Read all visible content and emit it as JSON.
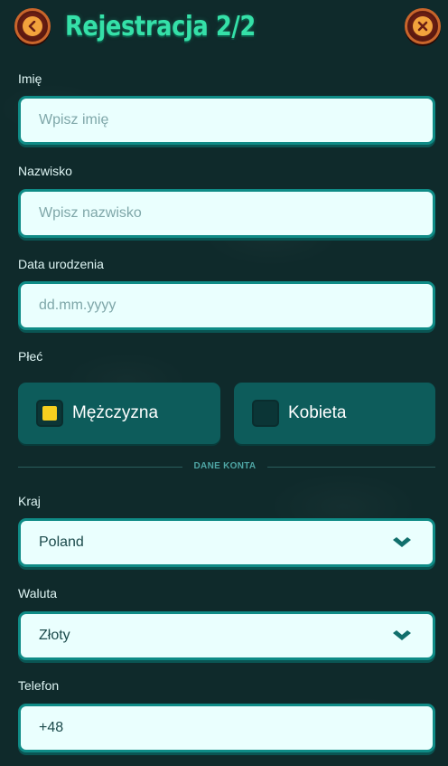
{
  "header": {
    "title": "Rejestracja 2/2",
    "back_icon": "back-arrow-icon",
    "close_icon": "close-x-icon"
  },
  "form": {
    "first_name": {
      "label": "Imię",
      "placeholder": "Wpisz imię"
    },
    "last_name": {
      "label": "Nazwisko",
      "placeholder": "Wpisz nazwisko"
    },
    "birth_date": {
      "label": "Data urodzenia",
      "placeholder": "dd.mm.yyyy"
    },
    "gender": {
      "label": "Płeć",
      "options": [
        {
          "label": "Mężczyzna",
          "selected": true
        },
        {
          "label": "Kobieta",
          "selected": false
        }
      ]
    },
    "section_title": "DANE KONTA",
    "country": {
      "label": "Kraj",
      "value": "Poland"
    },
    "currency": {
      "label": "Waluta",
      "value": "Złoty"
    },
    "phone": {
      "label": "Telefon",
      "value": "+48"
    }
  },
  "colors": {
    "background": "#0f2a2b",
    "title": "#35e0a8",
    "field_bg": "#eafffe",
    "field_border": "#0f8b86",
    "gender_bg": "#0d5c5b",
    "checkbox_selected": "#f7cf1f",
    "button_bg": "#6b1f14",
    "button_ring": "#c9652b"
  }
}
